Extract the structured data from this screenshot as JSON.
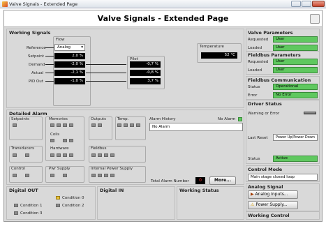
{
  "window": {
    "title": "Valve Signals - Extended Page"
  },
  "header": {
    "title": "Valve Signals - Extended Page"
  },
  "working_signals": {
    "title": "Working Signals",
    "flow_label": "Flow",
    "reference_label": "Reference",
    "reference_value": "Analog",
    "rows": [
      {
        "label": "Setpoint",
        "flow": "2,0 %",
        "pilot": ""
      },
      {
        "label": "Demand",
        "flow": "-2,0 %",
        "pilot": "-0,7 %"
      },
      {
        "label": "Actual",
        "flow": "-2,1 %",
        "pilot": "-0,8 %"
      },
      {
        "label": "PID Out",
        "flow": "-1,0 %",
        "pilot": "3,7 %"
      }
    ],
    "pilot_label": "Pilot",
    "temperature_label": "Temperature",
    "temperature_value": "52 °C"
  },
  "detailed_alarm": {
    "title": "Detailed Alarm",
    "setpoints": "Setpoints",
    "memories": "Memories",
    "outputs": "Outputs",
    "temp": "Temp.",
    "coils": "Coils",
    "transducers": "Transducers",
    "hardware": "Hardware",
    "fieldbus": "Fieldbus",
    "control": "Control",
    "pwr_supply": "Pwr Supply",
    "internal_power": "Internal Power Supply",
    "alarm_history": "Alarm History",
    "no_alarm": "No Alarm",
    "history_text": "No Alarm",
    "total_label": "Total Alarm Number",
    "total_value": "0",
    "more_button": "More..."
  },
  "digital_out": {
    "title": "Digital OUT",
    "items": [
      "Condition 0",
      "Condition 1",
      "Condition 2",
      "Condition 3"
    ]
  },
  "digital_in": {
    "title": "Digital IN"
  },
  "working_status": {
    "title": "Working Status"
  },
  "right": {
    "valve_params": {
      "title": "Valve Parameters",
      "requested": "Requested",
      "requested_val": "User",
      "loaded": "Loaded",
      "loaded_val": "User"
    },
    "fieldbus_params": {
      "title": "Fieldbus Parameters",
      "requested": "Requested",
      "requested_val": "User",
      "loaded": "Loaded",
      "loaded_val": "User"
    },
    "fieldbus_comm": {
      "title": "Fieldbus Communication",
      "status": "Status",
      "status_val": "Operational",
      "error": "Error",
      "error_val": "No Error"
    },
    "driver_status": {
      "title": "Driver Status",
      "warning": "Warning or Error",
      "last_reset": "Last Reset",
      "last_reset_val": "Power Up/Power Down",
      "status": "Status",
      "status_val": "Active"
    },
    "control_mode": {
      "title": "Control Mode",
      "value": "Main stage closed loop"
    },
    "analog_signal": {
      "title": "Analog Signal",
      "analog_btn": "Analog Inputs...",
      "power_btn": "Power Supply..."
    },
    "working_control": {
      "title": "Working Control"
    }
  }
}
